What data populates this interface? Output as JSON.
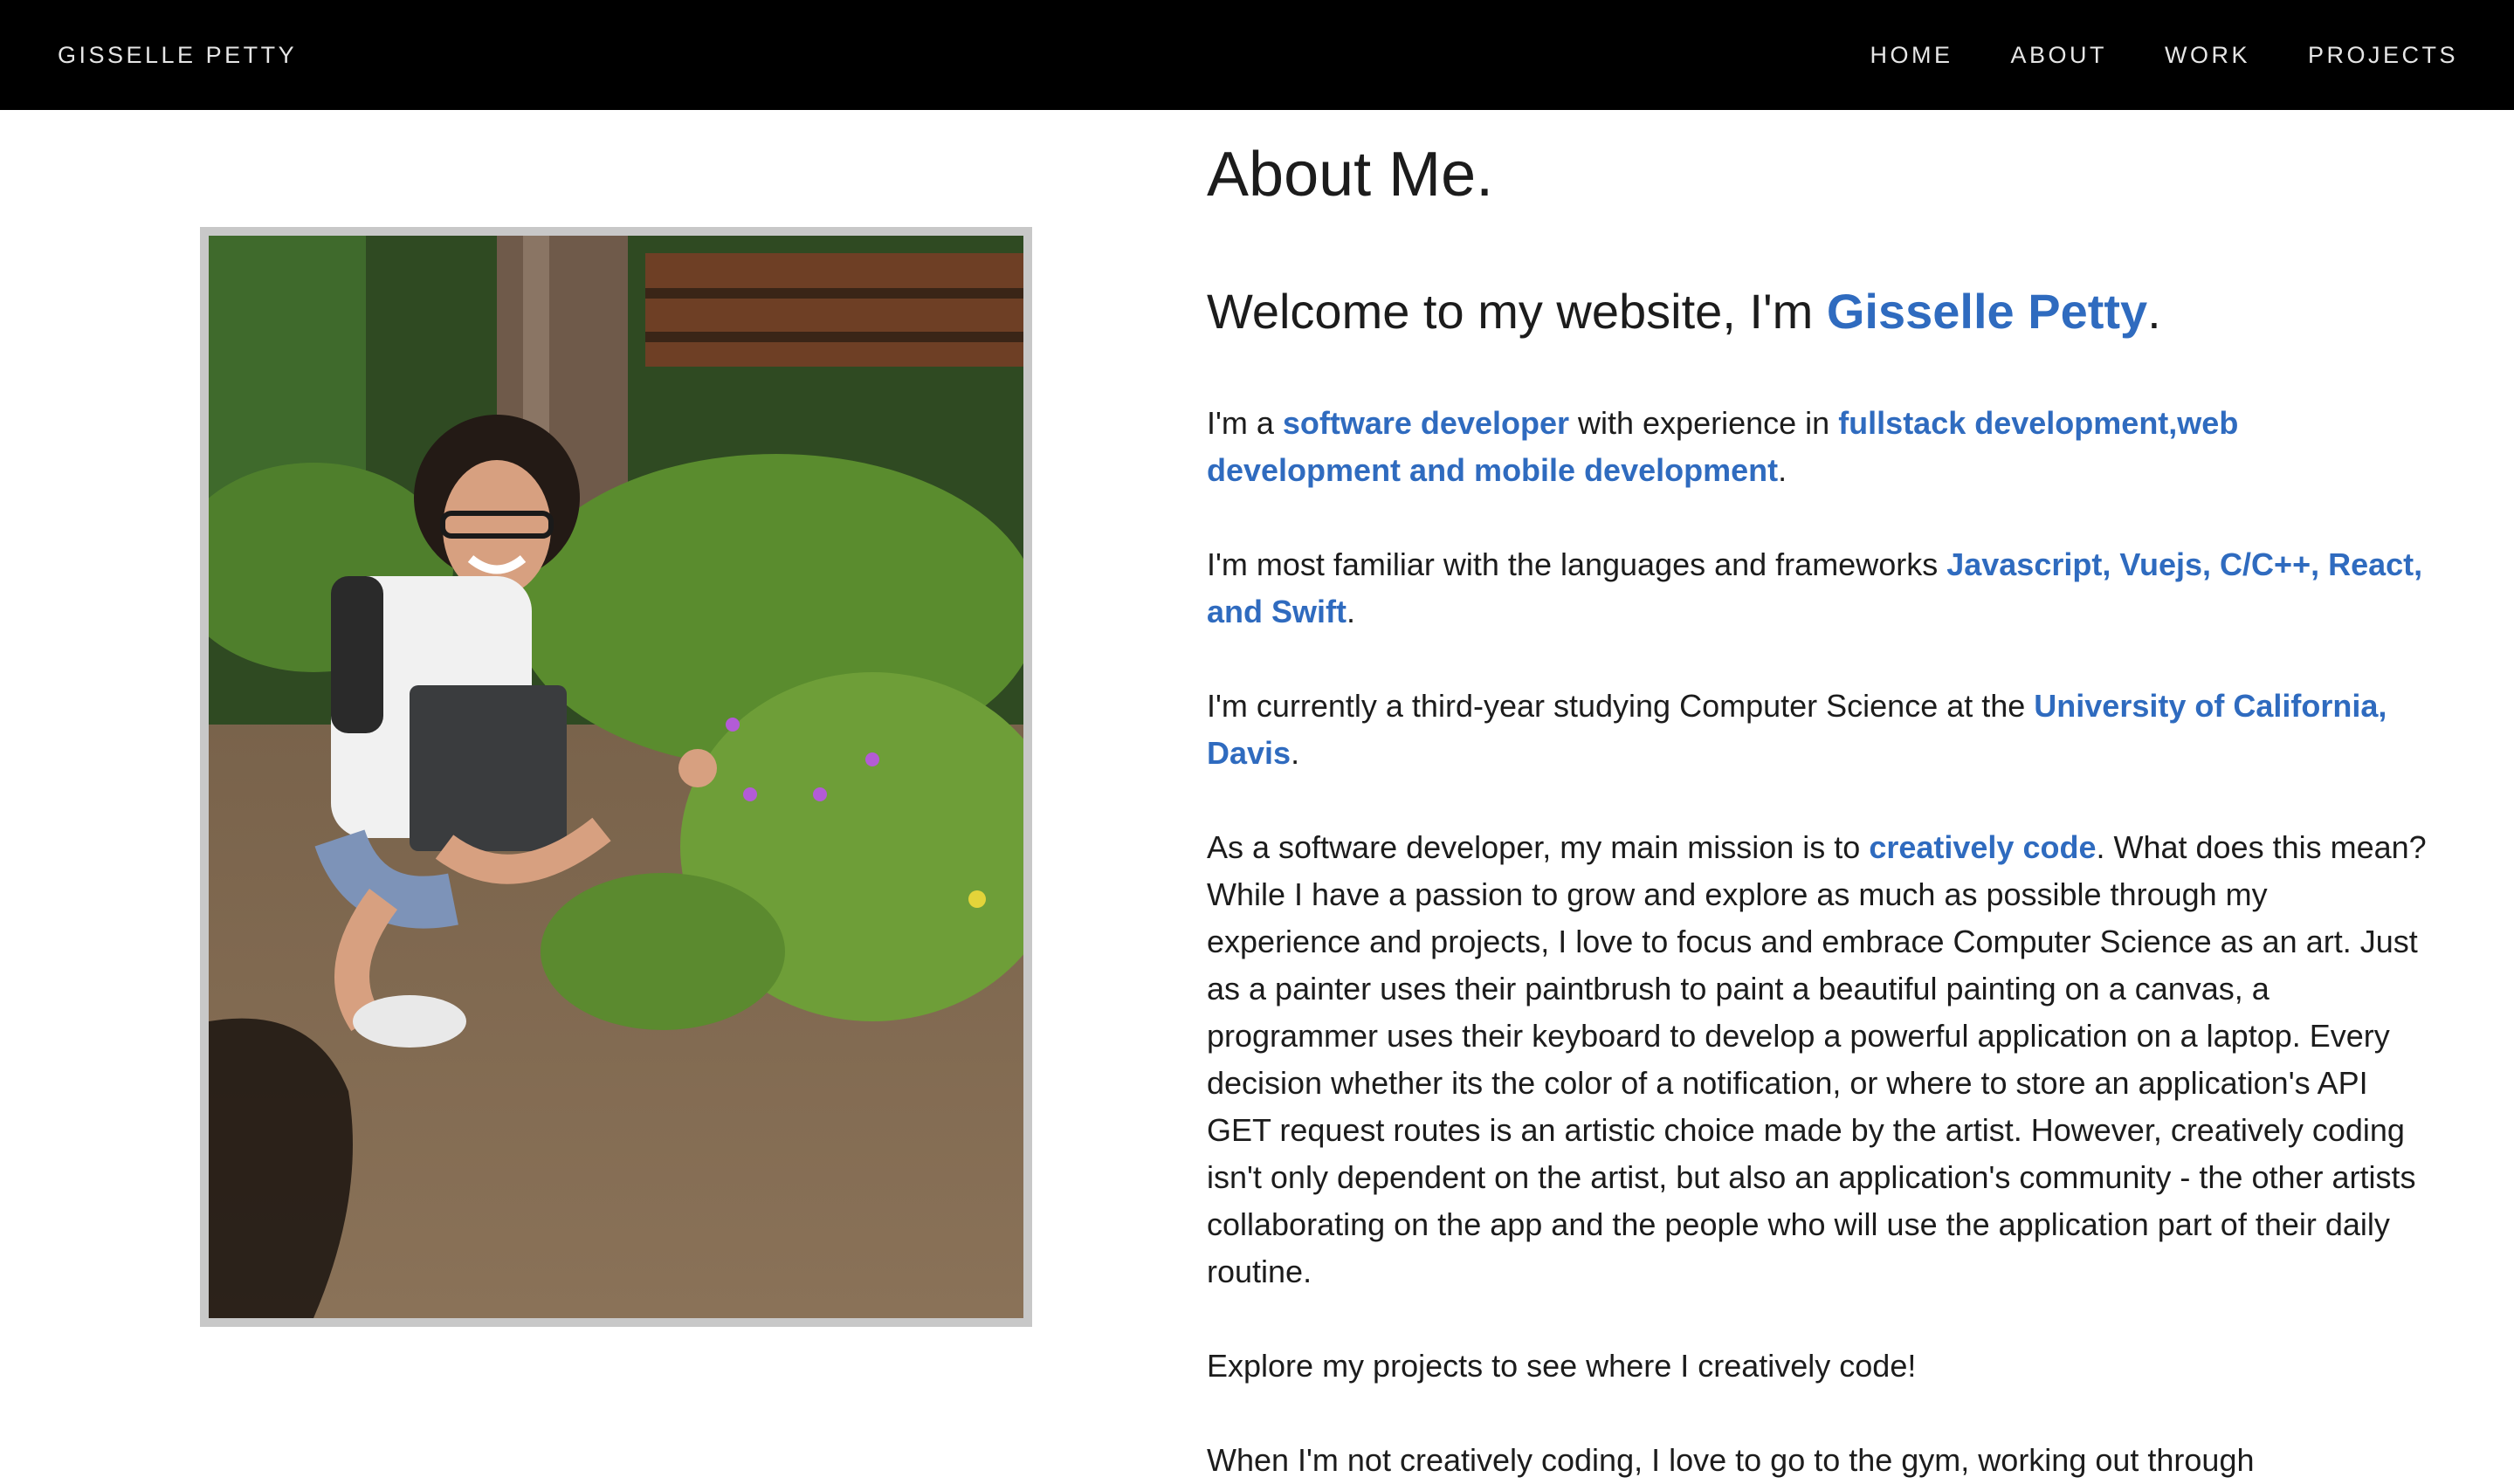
{
  "nav": {
    "brand": "GISSELLE PETTY",
    "links": [
      "HOME",
      "ABOUT",
      "WORK",
      "PROJECTS"
    ]
  },
  "photo": {
    "alt_icon": "portrait-photo"
  },
  "about": {
    "title": "About Me.",
    "welcome_prefix": "Welcome to my website, I'm ",
    "welcome_name": "Gisselle Petty",
    "welcome_suffix": ".",
    "p1": {
      "t1": "I'm a ",
      "h1": "software developer",
      "t2": " with experience in ",
      "h2": "fullstack development,web development and mobile development",
      "t3": "."
    },
    "p2": {
      "t1": "I'm most familiar with the languages and frameworks ",
      "h1": "Javascript, Vuejs, C/C++, React, and Swift",
      "t2": "."
    },
    "p3": {
      "t1": "I'm currently a third-year studying Computer Science at the ",
      "h1": "University of California, Davis",
      "t2": "."
    },
    "p4": {
      "t1": "As a software developer, my main mission is to ",
      "h1": "creatively code",
      "t2": ". What does this mean? While I have a passion to grow and explore as much as possible through my experience and projects, I love to focus and embrace Computer Science as an art. Just as a painter uses their paintbrush to paint a beautiful painting on a canvas, a programmer uses their keyboard to develop a powerful application on a laptop. Every decision whether its the color of a notification, or where to store an application's API GET request routes is an artistic choice made by the artist. However, creatively coding isn't only dependent on the artist, but also an application's community - the other artists collaborating on the app and the people who will use the application part of their daily routine."
    },
    "p5": "Explore my projects to see where I creatively code!",
    "p6": "When I'm not creatively coding, I love to go to the gym, working out through"
  },
  "colors": {
    "accent": "#2f6bbf",
    "nav_bg": "#000000",
    "frame": "#c8c8c8"
  }
}
